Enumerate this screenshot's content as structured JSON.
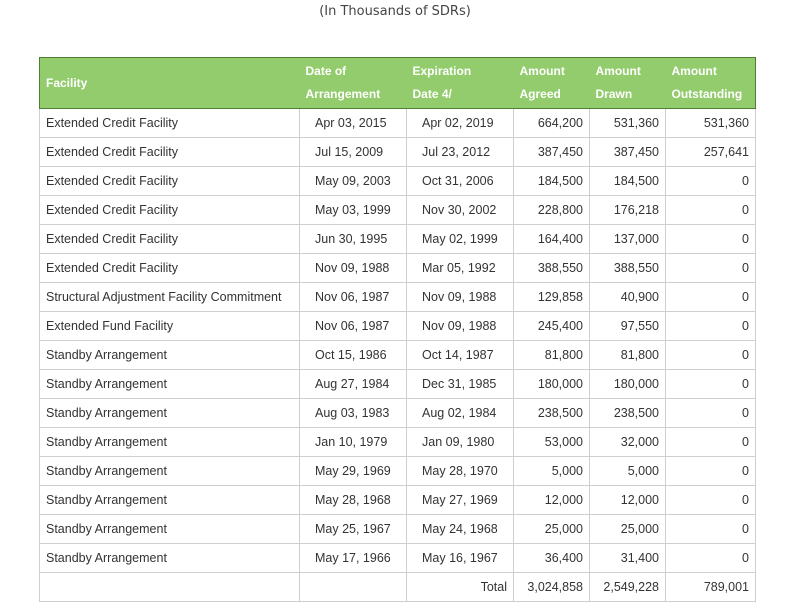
{
  "subtitle": "(In Thousands of SDRs)",
  "table": {
    "headers": {
      "facility": "Facility",
      "date_of_line1": "Date of",
      "date_of_line2": "Arrangement",
      "expiration_line1": "Expiration",
      "expiration_line2": "Date  4/",
      "agreed_line1": "Amount",
      "agreed_line2": "Agreed",
      "drawn_line1": "Amount",
      "drawn_line2": "Drawn",
      "outstanding_line1": "Amount",
      "outstanding_line2": "Outstanding"
    },
    "rows": [
      {
        "facility": "Extended Credit Facility",
        "date": "Apr 03, 2015",
        "expiration": "Apr 02, 2019",
        "agreed": "664,200",
        "drawn": "531,360",
        "outstanding": "531,360"
      },
      {
        "facility": "Extended Credit Facility",
        "date": "Jul 15, 2009",
        "expiration": "Jul 23, 2012",
        "agreed": "387,450",
        "drawn": "387,450",
        "outstanding": "257,641"
      },
      {
        "facility": "Extended Credit Facility",
        "date": "May 09, 2003",
        "expiration": "Oct 31, 2006",
        "agreed": "184,500",
        "drawn": "184,500",
        "outstanding": "0"
      },
      {
        "facility": "Extended Credit Facility",
        "date": "May 03, 1999",
        "expiration": "Nov 30, 2002",
        "agreed": "228,800",
        "drawn": "176,218",
        "outstanding": "0"
      },
      {
        "facility": "Extended Credit Facility",
        "date": "Jun 30, 1995",
        "expiration": "May 02, 1999",
        "agreed": "164,400",
        "drawn": "137,000",
        "outstanding": "0"
      },
      {
        "facility": "Extended Credit Facility",
        "date": "Nov 09, 1988",
        "expiration": "Mar 05, 1992",
        "agreed": "388,550",
        "drawn": "388,550",
        "outstanding": "0"
      },
      {
        "facility": "Structural Adjustment Facility Commitment",
        "date": "Nov 06, 1987",
        "expiration": "Nov 09, 1988",
        "agreed": "129,858",
        "drawn": "40,900",
        "outstanding": "0"
      },
      {
        "facility": "Extended Fund Facility",
        "date": "Nov 06, 1987",
        "expiration": "Nov 09, 1988",
        "agreed": "245,400",
        "drawn": "97,550",
        "outstanding": "0"
      },
      {
        "facility": "Standby Arrangement",
        "date": "Oct 15, 1986",
        "expiration": "Oct 14, 1987",
        "agreed": "81,800",
        "drawn": "81,800",
        "outstanding": "0"
      },
      {
        "facility": "Standby Arrangement",
        "date": "Aug 27, 1984",
        "expiration": "Dec 31, 1985",
        "agreed": "180,000",
        "drawn": "180,000",
        "outstanding": "0"
      },
      {
        "facility": "Standby Arrangement",
        "date": "Aug 03, 1983",
        "expiration": "Aug 02, 1984",
        "agreed": "238,500",
        "drawn": "238,500",
        "outstanding": "0"
      },
      {
        "facility": "Standby Arrangement",
        "date": "Jan 10, 1979",
        "expiration": "Jan 09, 1980",
        "agreed": "53,000",
        "drawn": "32,000",
        "outstanding": "0"
      },
      {
        "facility": "Standby Arrangement",
        "date": "May 29, 1969",
        "expiration": "May 28, 1970",
        "agreed": "5,000",
        "drawn": "5,000",
        "outstanding": "0"
      },
      {
        "facility": "Standby Arrangement",
        "date": "May 28, 1968",
        "expiration": "May 27, 1969",
        "agreed": "12,000",
        "drawn": "12,000",
        "outstanding": "0"
      },
      {
        "facility": "Standby Arrangement",
        "date": "May 25, 1967",
        "expiration": "May 24, 1968",
        "agreed": "25,000",
        "drawn": "25,000",
        "outstanding": "0"
      },
      {
        "facility": "Standby Arrangement",
        "date": "May 17, 1966",
        "expiration": "May 16, 1967",
        "agreed": "36,400",
        "drawn": "31,400",
        "outstanding": "0"
      }
    ],
    "total": {
      "label": "Total",
      "agreed": "3,024,858",
      "drawn": "2,549,228",
      "outstanding": "789,001"
    }
  },
  "colors": {
    "header_background": "#93cc6d",
    "header_text": "#ffffff",
    "cell_border": "#cfcfcf"
  }
}
